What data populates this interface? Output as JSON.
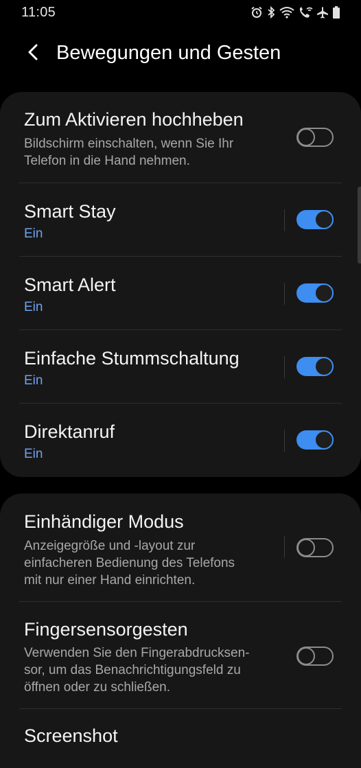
{
  "status_bar": {
    "time": "11:05",
    "icons": [
      "alarm-icon",
      "bluetooth-icon",
      "wifi-icon",
      "wifi-calling-icon",
      "airplane-icon",
      "battery-icon"
    ]
  },
  "header": {
    "title": "Bewegungen und Gesten"
  },
  "colors": {
    "background": "#000000",
    "card": "#171717",
    "accent": "#3e8df0",
    "status_text": "#6fa2ee",
    "description_text": "#a8a8a8"
  },
  "section1": {
    "items": [
      {
        "title": "Zum Aktivieren hochheben",
        "description": "Bildschirm einschalten, wenn Sie Ihr Telefon in die Hand nehmen.",
        "enabled": false
      },
      {
        "title": "Smart Stay",
        "status": "Ein",
        "enabled": true
      },
      {
        "title": "Smart Alert",
        "status": "Ein",
        "enabled": true
      },
      {
        "title": "Einfache Stummschaltung",
        "status": "Ein",
        "enabled": true
      },
      {
        "title": "Direktanruf",
        "status": "Ein",
        "enabled": true
      }
    ]
  },
  "section2": {
    "items": [
      {
        "title": "Einhändiger Modus",
        "description_lines": [
          "Anzeigegröße und -layout zur",
          "einfacheren Bedienung des Telefons",
          "mit nur einer Hand einrichten."
        ],
        "enabled": false
      },
      {
        "title": "Fingersensorgesten",
        "description_lines": [
          "Verwenden Sie den Fingerabdrucksen-",
          "sor, um das Benachrichtigungsfeld zu",
          "öffnen oder zu schließen."
        ],
        "enabled": false
      },
      {
        "title": "Screenshot"
      }
    ]
  }
}
